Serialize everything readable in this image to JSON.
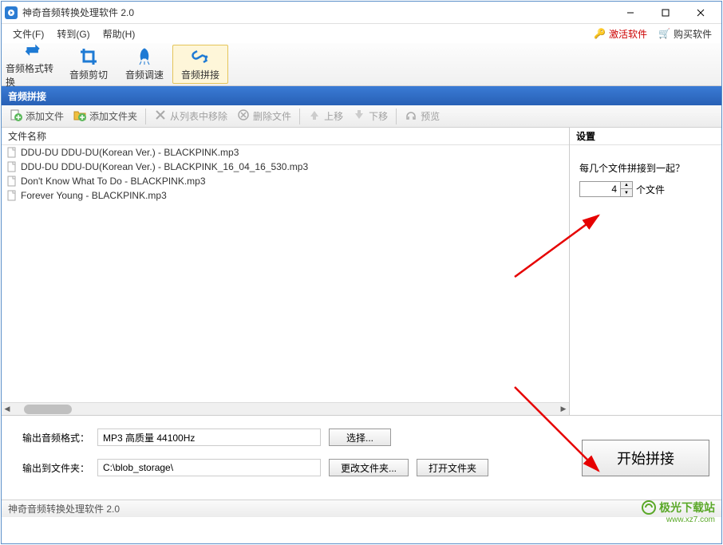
{
  "title": "神奇音频转换处理软件 2.0",
  "menu": {
    "file": "文件(F)",
    "goto": "转到(G)",
    "help": "帮助(H)",
    "activate": "激活软件",
    "buy": "购买软件"
  },
  "maintoolbar": {
    "format": "音频格式转换",
    "cut": "音频剪切",
    "speed": "音频调速",
    "join": "音频拼接"
  },
  "section_title": "音频拼接",
  "subtoolbar": {
    "add_file": "添加文件",
    "add_folder": "添加文件夹",
    "remove_list": "从列表中移除",
    "delete_file": "删除文件",
    "move_up": "上移",
    "move_down": "下移",
    "preview": "预览"
  },
  "file_header": "文件名称",
  "files": [
    "DDU-DU DDU-DU(Korean Ver.) - BLACKPINK.mp3",
    "DDU-DU DDU-DU(Korean Ver.) - BLACKPINK_16_04_16_530.mp3",
    "Don't Know What To Do - BLACKPINK.mp3",
    "Forever Young - BLACKPINK.mp3"
  ],
  "settings": {
    "header": "设置",
    "question": "每几个文件拼接到一起？",
    "value": "4",
    "unit": "个文件"
  },
  "output": {
    "format_label": "输出音频格式：",
    "format_value": "MP3 高质量 44100Hz",
    "select_btn": "选择...",
    "folder_label": "输出到文件夹：",
    "folder_value": "C:\\blob_storage\\",
    "change_btn": "更改文件夹...",
    "open_btn": "打开文件夹"
  },
  "start_btn": "开始拼接",
  "statusbar": "神奇音频转换处理软件 2.0",
  "watermark": {
    "name": "极光下载站",
    "url": "www.xz7.com"
  }
}
